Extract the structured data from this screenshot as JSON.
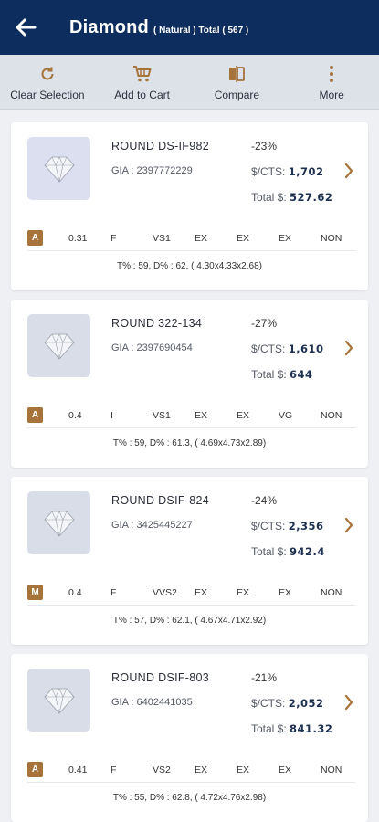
{
  "header": {
    "title": "Diamond",
    "subtitle": "( Natural ) Total ( 567 )"
  },
  "toolbar": [
    {
      "label": "Clear Selection",
      "icon": "refresh-icon"
    },
    {
      "label": "Add to Cart",
      "icon": "cart-icon"
    },
    {
      "label": "Compare",
      "icon": "compare-icon"
    },
    {
      "label": "More",
      "icon": "more-vertical-icon"
    }
  ],
  "items": [
    {
      "name": "ROUND DS-IF982",
      "gia": "GIA : 2397772229",
      "discount": "-23%",
      "pct_label": "$/CTS:",
      "pct_value": "1,702",
      "total_label": "Total $:",
      "total_value": "527.62",
      "badge": "A",
      "carat": "0.31",
      "color": "F",
      "clarity": "VS1",
      "cut": "EX",
      "polish": "EX",
      "symmetry": "EX",
      "fluor": "NON",
      "measurements": "T% : 59, D% : 62, ( 4.30x4.33x2.68)"
    },
    {
      "name": "ROUND 322-134",
      "gia": "GIA : 2397690454",
      "discount": "-27%",
      "pct_label": "$/CTS:",
      "pct_value": "1,610",
      "total_label": "Total $:",
      "total_value": "644",
      "badge": "A",
      "carat": "0.4",
      "color": "I",
      "clarity": "VS1",
      "cut": "EX",
      "polish": "EX",
      "symmetry": "VG",
      "fluor": "NON",
      "measurements": "T% : 59, D% : 61.3, ( 4.69x4.73x2.89)"
    },
    {
      "name": "ROUND DSIF-824",
      "gia": "GIA : 3425445227",
      "discount": "-24%",
      "pct_label": "$/CTS:",
      "pct_value": "2,356",
      "total_label": "Total $:",
      "total_value": "942.4",
      "badge": "M",
      "carat": "0.4",
      "color": "F",
      "clarity": "VVS2",
      "cut": "EX",
      "polish": "EX",
      "symmetry": "EX",
      "fluor": "NON",
      "measurements": "T% : 57, D% : 62.1, ( 4.67x4.71x2.92)"
    },
    {
      "name": "ROUND DSIF-803",
      "gia": "GIA : 6402441035",
      "discount": "-21%",
      "pct_label": "$/CTS:",
      "pct_value": "2,052",
      "total_label": "Total $:",
      "total_value": "841.32",
      "badge": "A",
      "carat": "0.41",
      "color": "F",
      "clarity": "VS2",
      "cut": "EX",
      "polish": "EX",
      "symmetry": "EX",
      "fluor": "NON",
      "measurements": "T% : 55, D% : 62.8, ( 4.72x4.76x2.98)"
    }
  ],
  "colors": {
    "header": "#0c2d5e",
    "accent": "#a6733a"
  }
}
